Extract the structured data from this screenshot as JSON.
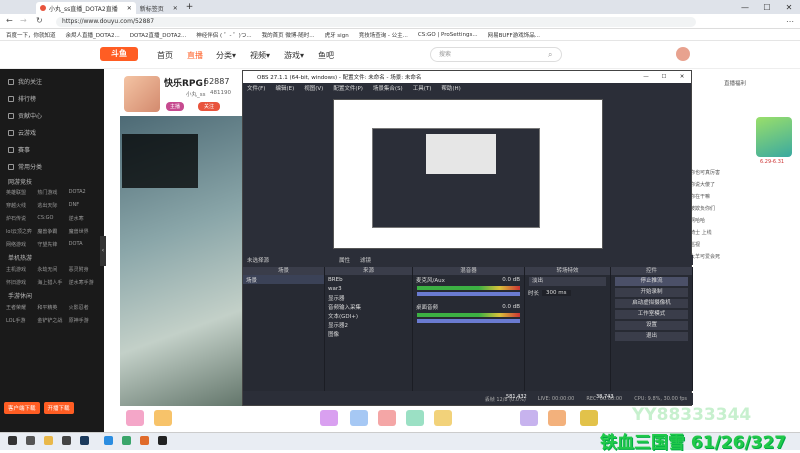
{
  "browser": {
    "tabs": [
      {
        "label": "小丸_ss直播_DOTA2直播"
      },
      {
        "label": "新标签页"
      }
    ],
    "url": "https://www.douyu.com/52887",
    "bookmarks": [
      "百度一下，你就知道",
      "余烬人直播_DOTA2...",
      "DOTA2直播_DOTA2...",
      "神经伴侣 ( ゜- ゜)つ...",
      "我的首页 微博-随时...",
      "虎牙 sign",
      "竞技场查询 - 公主...",
      "CS:GO | ProSettings...",
      "网易BUFF游戏饰品..."
    ]
  },
  "site": {
    "logo": "斗鱼",
    "nav": [
      "首页",
      "直播",
      "分类▾",
      "视频▾",
      "游戏▾",
      "鱼吧"
    ],
    "search_placeholder": "搜索"
  },
  "sidebar": {
    "items": [
      "我的关注",
      "排行榜",
      "贡献中心",
      "云游戏",
      "赛事"
    ],
    "section1": "常用分类",
    "section2": "网游竞技",
    "cats1": [
      "英雄联盟",
      "热门游戏",
      "DOTA2",
      "穿越火线",
      "逃出天际",
      "DNF",
      "炉石传说",
      "CS:GO",
      "逆水寒",
      "lol云顶之弈",
      "魔兽争霸",
      "魔兽世界",
      "网络游戏",
      "守望先锋",
      "DOTA"
    ],
    "section3": "单机热游",
    "cats2": [
      "主机游戏",
      "永劫无间",
      "恶灵附身",
      "怀旧游戏",
      "海上猎人手",
      "逆水寒手游"
    ],
    "section4": "手游休闲",
    "cats3": [
      "王者荣耀",
      "和平精英",
      "火影忍者",
      "LOL手游",
      "金铲铲之战",
      "原神手游"
    ],
    "btn_left": "客户端下载",
    "btn_right": "开播下载"
  },
  "stream": {
    "title": "快乐RPG!",
    "room_id": "52887",
    "streamer": "小丸_ss",
    "fans": "481190",
    "follow_label": "关注",
    "badge": "主播"
  },
  "obs": {
    "title": "OBS 27.1.1 (64-bit, windows) - 配置文件: 未命名 - 场景: 未命名",
    "menu": [
      "文件(F)",
      "编辑(E)",
      "视图(V)",
      "配置文件(P)",
      "场景集合(S)",
      "工具(T)",
      "帮助(H)"
    ],
    "docks": {
      "scenes": "场景",
      "sources": "来源",
      "mixer": "混音器",
      "transitions": "转场特效",
      "controls": "控件"
    },
    "scene_items": [
      "场景"
    ],
    "source_items": [
      "BREb",
      "war3",
      "显示器",
      "音频输入采集",
      "文本(GDI+)",
      "显示器2",
      "图像"
    ],
    "mixer_tracks": [
      {
        "name": "麦克风/Aux",
        "level": "0.0 dB"
      },
      {
        "name": "桌面音频",
        "level": "0.0 dB"
      }
    ],
    "transition_type": "淡出",
    "duration_label": "时长",
    "duration_value": "300 ms",
    "control_buttons": [
      "停止推流",
      "开始录制",
      "启动虚拟摄像机",
      "工作室模式",
      "设置",
      "退出"
    ],
    "status": [
      "丢帧 12/8 (0.0%)",
      "LIVE: 00:00:00",
      "REC: 00:00:00",
      "CPU: 9.8%, 30.00 fps"
    ],
    "header_left": "未选择源",
    "props_label": "属性",
    "filters_label": "滤镜"
  },
  "right_panel": {
    "rank_label": "直播福利",
    "event_label": "6.29-6.31",
    "chat": [
      "你也可真厉害",
      "你说大傻了",
      "你在干嘛",
      "被欺负你们",
      "啊哈哈",
      "骑士 上线",
      "巡视",
      "大羊可爱会死"
    ]
  },
  "gift_bar": {
    "values": [
      "581,432",
      "38,743"
    ]
  },
  "overlay_text": "铁血三国雪 61/26/327",
  "watermark": "YY88333344",
  "colors": {
    "brand": "#ff5d23",
    "obs_bg": "#2b2e38",
    "overlay": "#21c94a"
  }
}
